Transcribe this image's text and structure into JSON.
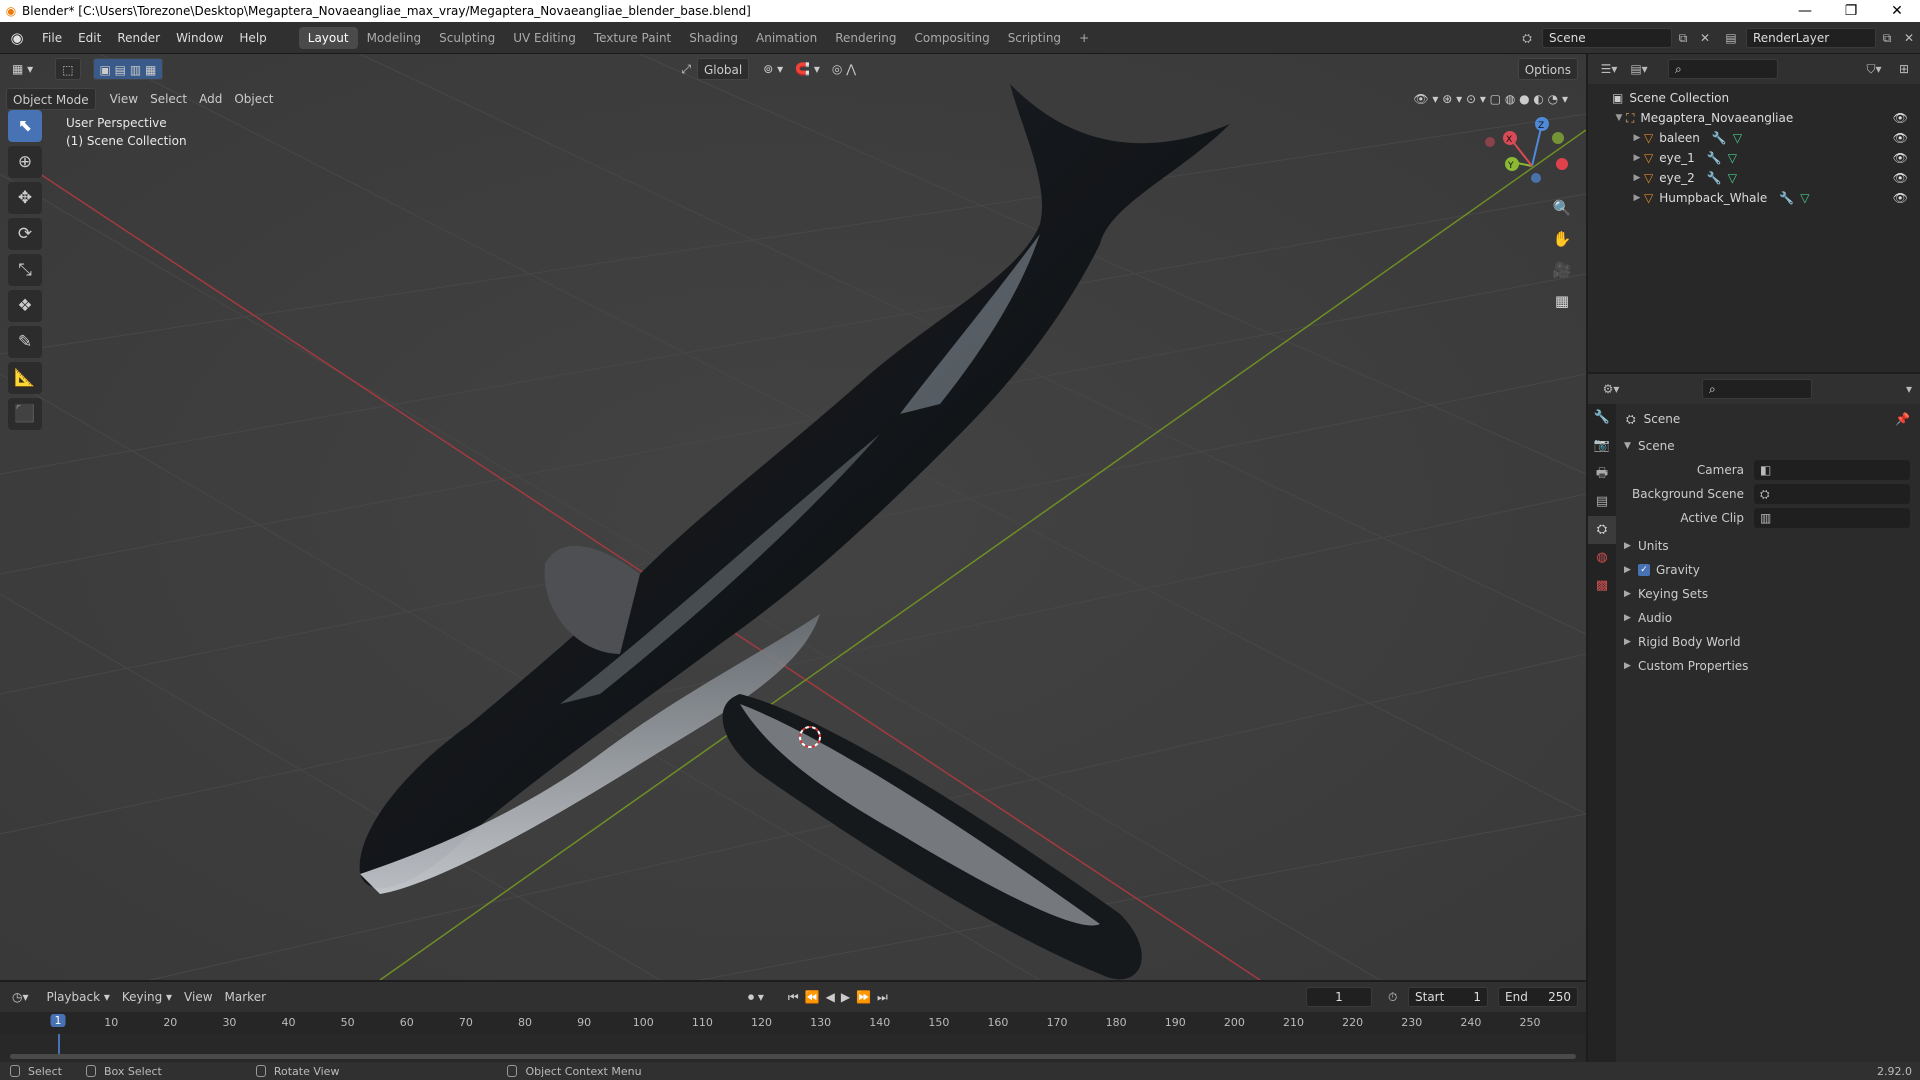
{
  "window": {
    "title": "Blender* [C:\\Users\\Torezone\\Desktop\\Megaptera_Novaeangliae_max_vray/Megaptera_Novaeangliae_blender_base.blend]"
  },
  "menus": [
    "File",
    "Edit",
    "Render",
    "Window",
    "Help"
  ],
  "workspaces": [
    "Layout",
    "Modeling",
    "Sculpting",
    "UV Editing",
    "Texture Paint",
    "Shading",
    "Animation",
    "Rendering",
    "Compositing",
    "Scripting"
  ],
  "scene_name": "Scene",
  "render_layer": "RenderLayer",
  "viewport": {
    "mode": "Object Mode",
    "header_menus": [
      "View",
      "Select",
      "Add",
      "Object"
    ],
    "transform_orientation": "Global",
    "options_label": "Options",
    "perspective": "User Perspective",
    "collection": "(1) Scene Collection",
    "gizmo": {
      "x": "X",
      "y": "Y",
      "z": "Z"
    }
  },
  "outliner": {
    "root": "Scene Collection",
    "collection": "Megaptera_Novaeangliae",
    "objects": [
      "baleen",
      "eye_1",
      "eye_2",
      "Humpback_Whale"
    ]
  },
  "properties": {
    "context": "Scene",
    "panel": "Scene",
    "fields": [
      {
        "label": "Camera",
        "value": ""
      },
      {
        "label": "Background Scene",
        "value": ""
      },
      {
        "label": "Active Clip",
        "value": ""
      }
    ],
    "subpanels": [
      {
        "label": "Units",
        "check": false
      },
      {
        "label": "Gravity",
        "check": true
      },
      {
        "label": "Keying Sets",
        "check": false
      },
      {
        "label": "Audio",
        "check": false
      },
      {
        "label": "Rigid Body World",
        "check": false
      },
      {
        "label": "Custom Properties",
        "check": false
      }
    ]
  },
  "timeline": {
    "menus": [
      "Playback",
      "Keying",
      "View",
      "Marker"
    ],
    "current_frame": "1",
    "start_label": "Start",
    "start": "1",
    "end_label": "End",
    "end": "250",
    "ticks": [
      "1",
      "10",
      "20",
      "30",
      "40",
      "50",
      "60",
      "70",
      "80",
      "90",
      "100",
      "110",
      "120",
      "130",
      "140",
      "150",
      "160",
      "170",
      "180",
      "190",
      "200",
      "210",
      "220",
      "230",
      "240",
      "250"
    ]
  },
  "status": {
    "items": [
      "Select",
      "Box Select",
      "Rotate View",
      "Object Context Menu"
    ],
    "version": "2.92.0"
  }
}
